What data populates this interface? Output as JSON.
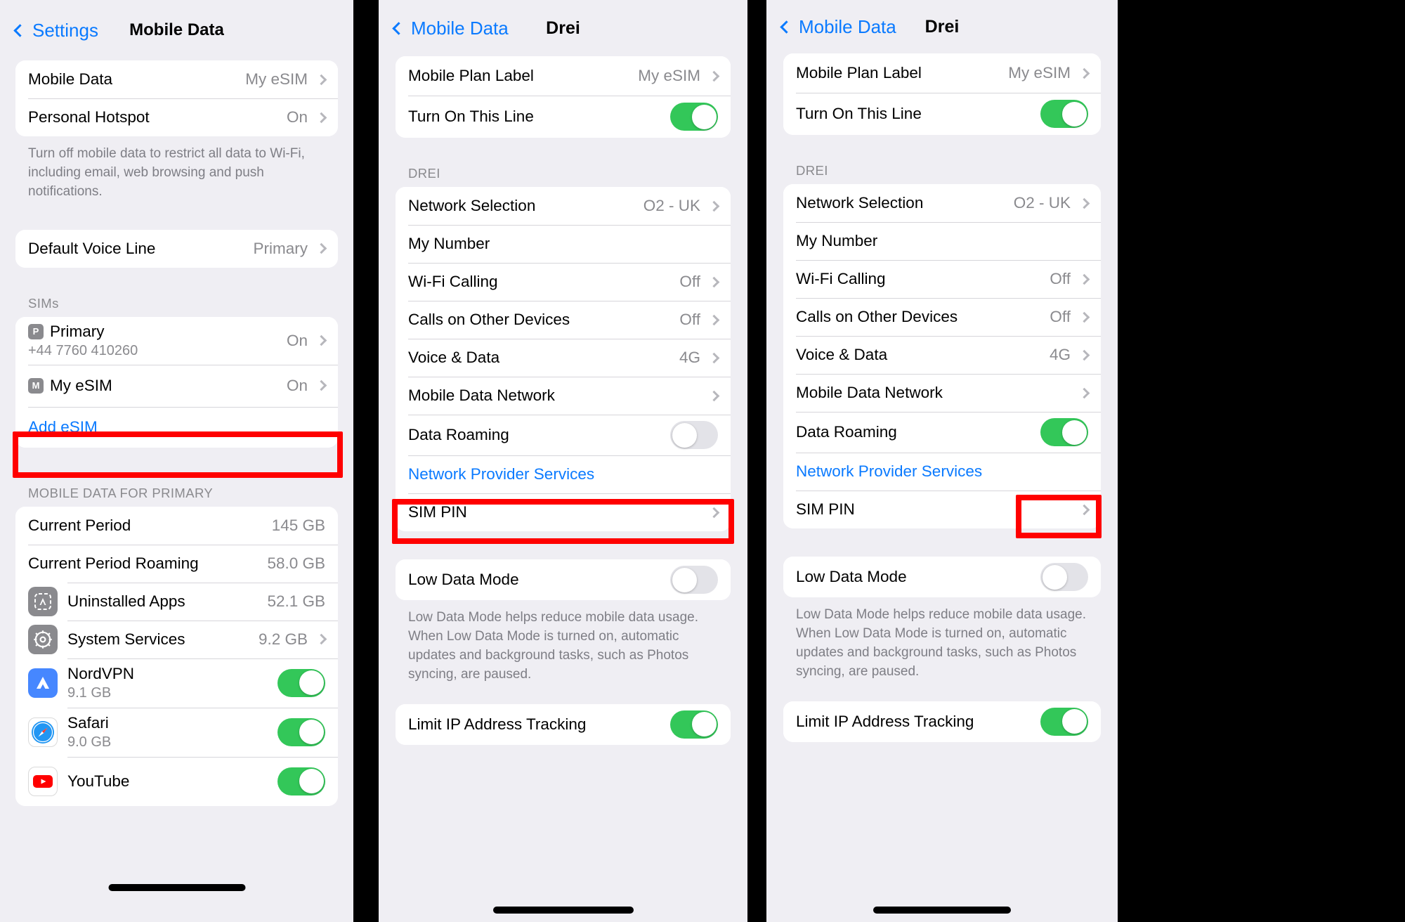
{
  "panel1": {
    "nav": {
      "back_label": "Settings",
      "title": "Mobile Data"
    },
    "group_data": [
      {
        "label": "Mobile Data",
        "value": "My eSIM",
        "chevron": true
      },
      {
        "label": "Personal Hotspot",
        "value": "On",
        "chevron": true
      }
    ],
    "footnote": "Turn off mobile data to restrict all data to Wi-Fi, including email, web browsing and push notifications.",
    "group_voice": [
      {
        "label": "Default Voice Line",
        "value": "Primary",
        "chevron": true
      }
    ],
    "sims_header": "SIMs",
    "sims": [
      {
        "badge": "P",
        "label": "Primary",
        "sub": "+44 7760 410260",
        "value": "On",
        "chevron": true
      },
      {
        "badge": "M",
        "label": "My eSIM",
        "sub": "",
        "value": "On",
        "chevron": true
      }
    ],
    "add_esim_label": "Add eSIM",
    "usage_header": "MOBILE DATA FOR PRIMARY",
    "usage_rows": [
      {
        "label": "Current Period",
        "value": "145 GB",
        "chevron": false,
        "icon": ""
      },
      {
        "label": "Current Period Roaming",
        "value": "58.0 GB",
        "chevron": false,
        "icon": ""
      },
      {
        "label": "Uninstalled Apps",
        "value": "52.1 GB",
        "chevron": false,
        "icon": "app-store-icon"
      },
      {
        "label": "System Services",
        "value": "9.2 GB",
        "chevron": true,
        "icon": "system-services-gear-icon"
      }
    ],
    "apps": [
      {
        "label": "NordVPN",
        "sub": "9.1 GB",
        "icon": "nordvpn-icon",
        "toggle": true
      },
      {
        "label": "Safari",
        "sub": "9.0 GB",
        "icon": "safari-compass-icon",
        "toggle": true
      },
      {
        "label": "YouTube",
        "sub": "",
        "icon": "youtube-icon",
        "toggle": true
      }
    ],
    "highlight": "my-esim-row"
  },
  "panel2": {
    "nav": {
      "back_label": "Mobile Data",
      "title": "Drei"
    },
    "group_plan": [
      {
        "label": "Mobile Plan Label",
        "value": "My eSIM",
        "chevron": true,
        "toggle": null
      },
      {
        "label": "Turn On This Line",
        "value": "",
        "chevron": false,
        "toggle": true
      }
    ],
    "section_header": "DREI",
    "carrier_rows": [
      {
        "label": "Network Selection",
        "value": "O2 - UK",
        "chevron": true,
        "toggle": null
      },
      {
        "label": "My Number",
        "value": "",
        "chevron": false,
        "toggle": null
      },
      {
        "label": "Wi-Fi Calling",
        "value": "Off",
        "chevron": true,
        "toggle": null
      },
      {
        "label": "Calls on Other Devices",
        "value": "Off",
        "chevron": true,
        "toggle": null
      },
      {
        "label": "Voice & Data",
        "value": "4G",
        "chevron": true,
        "toggle": null
      },
      {
        "label": "Mobile Data Network",
        "value": "",
        "chevron": true,
        "toggle": null
      },
      {
        "label": "Data Roaming",
        "value": "",
        "chevron": false,
        "toggle": false
      },
      {
        "label": "Network Provider Services",
        "value": "",
        "chevron": false,
        "toggle": null,
        "blue": true
      },
      {
        "label": "SIM PIN",
        "value": "",
        "chevron": true,
        "toggle": null
      }
    ],
    "low_data": {
      "label": "Low Data Mode",
      "toggle": false
    },
    "low_data_note": "Low Data Mode helps reduce mobile data usage. When Low Data Mode is turned on, automatic updates and background tasks, such as Photos syncing, are paused.",
    "limit_ip": {
      "label": "Limit IP Address Tracking",
      "toggle": true
    },
    "highlight": "data-roaming-row"
  },
  "panel3": {
    "nav": {
      "back_label": "Mobile Data",
      "title": "Drei"
    },
    "group_plan": [
      {
        "label": "Mobile Plan Label",
        "value": "My eSIM",
        "chevron": true,
        "toggle": null
      },
      {
        "label": "Turn On This Line",
        "value": "",
        "chevron": false,
        "toggle": true
      }
    ],
    "section_header": "DREI",
    "carrier_rows": [
      {
        "label": "Network Selection",
        "value": "O2 - UK",
        "chevron": true,
        "toggle": null
      },
      {
        "label": "My Number",
        "value": "",
        "chevron": false,
        "toggle": null
      },
      {
        "label": "Wi-Fi Calling",
        "value": "Off",
        "chevron": true,
        "toggle": null
      },
      {
        "label": "Calls on Other Devices",
        "value": "Off",
        "chevron": true,
        "toggle": null
      },
      {
        "label": "Voice & Data",
        "value": "4G",
        "chevron": true,
        "toggle": null
      },
      {
        "label": "Mobile Data Network",
        "value": "",
        "chevron": true,
        "toggle": null
      },
      {
        "label": "Data Roaming",
        "value": "",
        "chevron": false,
        "toggle": true
      },
      {
        "label": "Network Provider Services",
        "value": "",
        "chevron": false,
        "toggle": null,
        "blue": true
      },
      {
        "label": "SIM PIN",
        "value": "",
        "chevron": true,
        "toggle": null
      }
    ],
    "low_data": {
      "label": "Low Data Mode",
      "toggle": false
    },
    "low_data_note": "Low Data Mode helps reduce mobile data usage. When Low Data Mode is turned on, automatic updates and background tasks, such as Photos syncing, are paused.",
    "limit_ip": {
      "label": "Limit IP Address Tracking",
      "toggle": true
    },
    "highlight": "data-roaming-toggle"
  },
  "colors": {
    "accent_blue": "#0A7AFF",
    "toggle_green": "#33C759",
    "highlight_red": "#FF0000",
    "page_bg": "#EFEEF3",
    "card_bg": "#FFFFFF",
    "secondary_text": "#8A8A8E"
  }
}
